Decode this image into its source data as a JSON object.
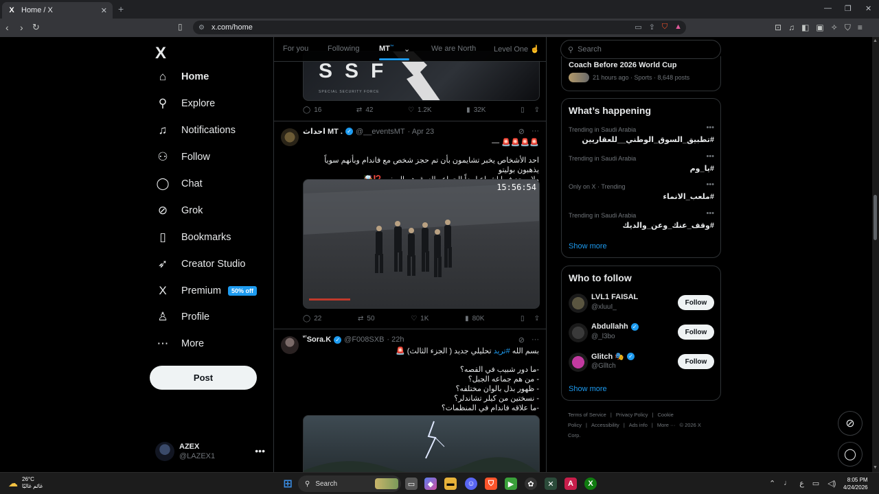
{
  "browser": {
    "tab_title": "Home / X",
    "tab_favicon": "X",
    "tab_close": "✕",
    "new_tab": "+",
    "url": "x.com/home"
  },
  "nav": {
    "logo": "X",
    "items": [
      {
        "label": "Home",
        "icon": "home-icon",
        "glyph": "⌂"
      },
      {
        "label": "Explore",
        "icon": "search-icon",
        "glyph": "⚲"
      },
      {
        "label": "Notifications",
        "icon": "bell-icon",
        "glyph": "♫"
      },
      {
        "label": "Follow",
        "icon": "person-add-icon",
        "glyph": "⚇"
      },
      {
        "label": "Chat",
        "icon": "chat-bubble-icon",
        "glyph": "◯"
      },
      {
        "label": "Grok",
        "icon": "grok-icon",
        "glyph": "⊘"
      },
      {
        "label": "Bookmarks",
        "icon": "bookmark-icon",
        "glyph": "▯"
      },
      {
        "label": "Creator Studio",
        "icon": "rocket-icon",
        "glyph": "➶"
      },
      {
        "label": "Premium",
        "icon": "x-premium-icon",
        "glyph": "X"
      },
      {
        "label": "Profile",
        "icon": "person-icon",
        "glyph": "♙"
      },
      {
        "label": "More",
        "icon": "more-circle-icon",
        "glyph": "⋯"
      }
    ],
    "premium_badge": "50% off",
    "post_label": "Post",
    "account": {
      "name": "AZEX",
      "handle": "@LAZEX1",
      "menu": "•••"
    }
  },
  "feed": {
    "tabs": [
      "For you",
      "Following",
      "MT",
      "We are North",
      "Level One ☝️"
    ],
    "active_tab_sup": "™",
    "tweets": [
      {
        "id": "partial",
        "stats": {
          "replies": "16",
          "reposts": "42",
          "likes": "1.2K",
          "views": "32K"
        }
      },
      {
        "name": "احداث MT .",
        "handle": "@__eventsMT",
        "time": "· Apr 23",
        "line1": "🚨🚨🚨🚨 —",
        "text": "احد الأشخاص يخبر تشايمون بأن تم حجز شخص مع فاندام وبأنهم سوياً يذهبون بوليتو\nولا يوجد فيها اشعاع ايضاً الجماعه الزرق هم الريفن ⁉️🤯",
        "timestamp": "15:56:54",
        "stats": {
          "replies": "22",
          "reposts": "50",
          "likes": "1K",
          "views": "80K"
        }
      },
      {
        "name": "Sora.K",
        "name_prefix": "ᴹᵀ",
        "handle": "@F008SXB",
        "time": "· 22h",
        "text_pre": "بسم الله ",
        "hashtag": "#تريد",
        "text_post": " تحليلي جديد ( الجزء الثالث) 🚨",
        "questions": "-ما دور شبيب في القصه؟\n- من هم جماعه الجبل؟\n- ظهور بذل بالوان مختلفه؟\n- نسختين من كيلر تشاندلر؟\n-ما علاقه فاندام في المنظمات؟"
      }
    ]
  },
  "sidebar": {
    "search_placeholder": "Search",
    "top_trend": {
      "title": "Coach Before 2026 World Cup",
      "meta": "21 hours ago · Sports · 8,648 posts"
    },
    "happening_title": "What’s happening",
    "trends": [
      {
        "meta": "Trending in Saudi Arabia",
        "tag": "#تطبيق_السوق_الوطني__للعقاريين"
      },
      {
        "meta": "Trending in Saudi Arabia",
        "tag": "#يا_وم"
      },
      {
        "meta": "Only on X · Trending",
        "tag": "#ملعب_الانماء"
      },
      {
        "meta": "Trending in Saudi Arabia",
        "tag": "#وقف_عنك_وعن_والديك"
      }
    ],
    "trend_more": "•••",
    "show_more": "Show more",
    "wtf_title": "Who to follow",
    "who_to_follow": [
      {
        "name": "LVL1 FAISAL",
        "handle": "@xluuI_",
        "verified": false,
        "avatar_color": "#5a5540"
      },
      {
        "name": "Abdullahh",
        "handle": "@_l3bo",
        "verified": true,
        "avatar_color": "#3a3a3a"
      },
      {
        "name": "Glitch 🎭",
        "handle": "@Glltch",
        "verified": true,
        "avatar_color": "#c23aa0"
      }
    ],
    "follow_label": "Follow",
    "footer": [
      "Terms of Service",
      "|",
      "Privacy Policy",
      "|",
      "Cookie Policy",
      "|",
      "Accessibility",
      "|",
      "Ads info",
      "|",
      "More ···",
      "© 2026 X Corp."
    ]
  },
  "taskbar": {
    "weather_temp": "26°C",
    "weather_desc": "غائم غالبًا",
    "search_label": "Search",
    "tray_lang": "ع",
    "time": "8:05 PM",
    "date": "4/24/2026"
  },
  "colors": {
    "accent": "#1d9bf0",
    "border": "#2f3336",
    "muted": "#71767b"
  }
}
